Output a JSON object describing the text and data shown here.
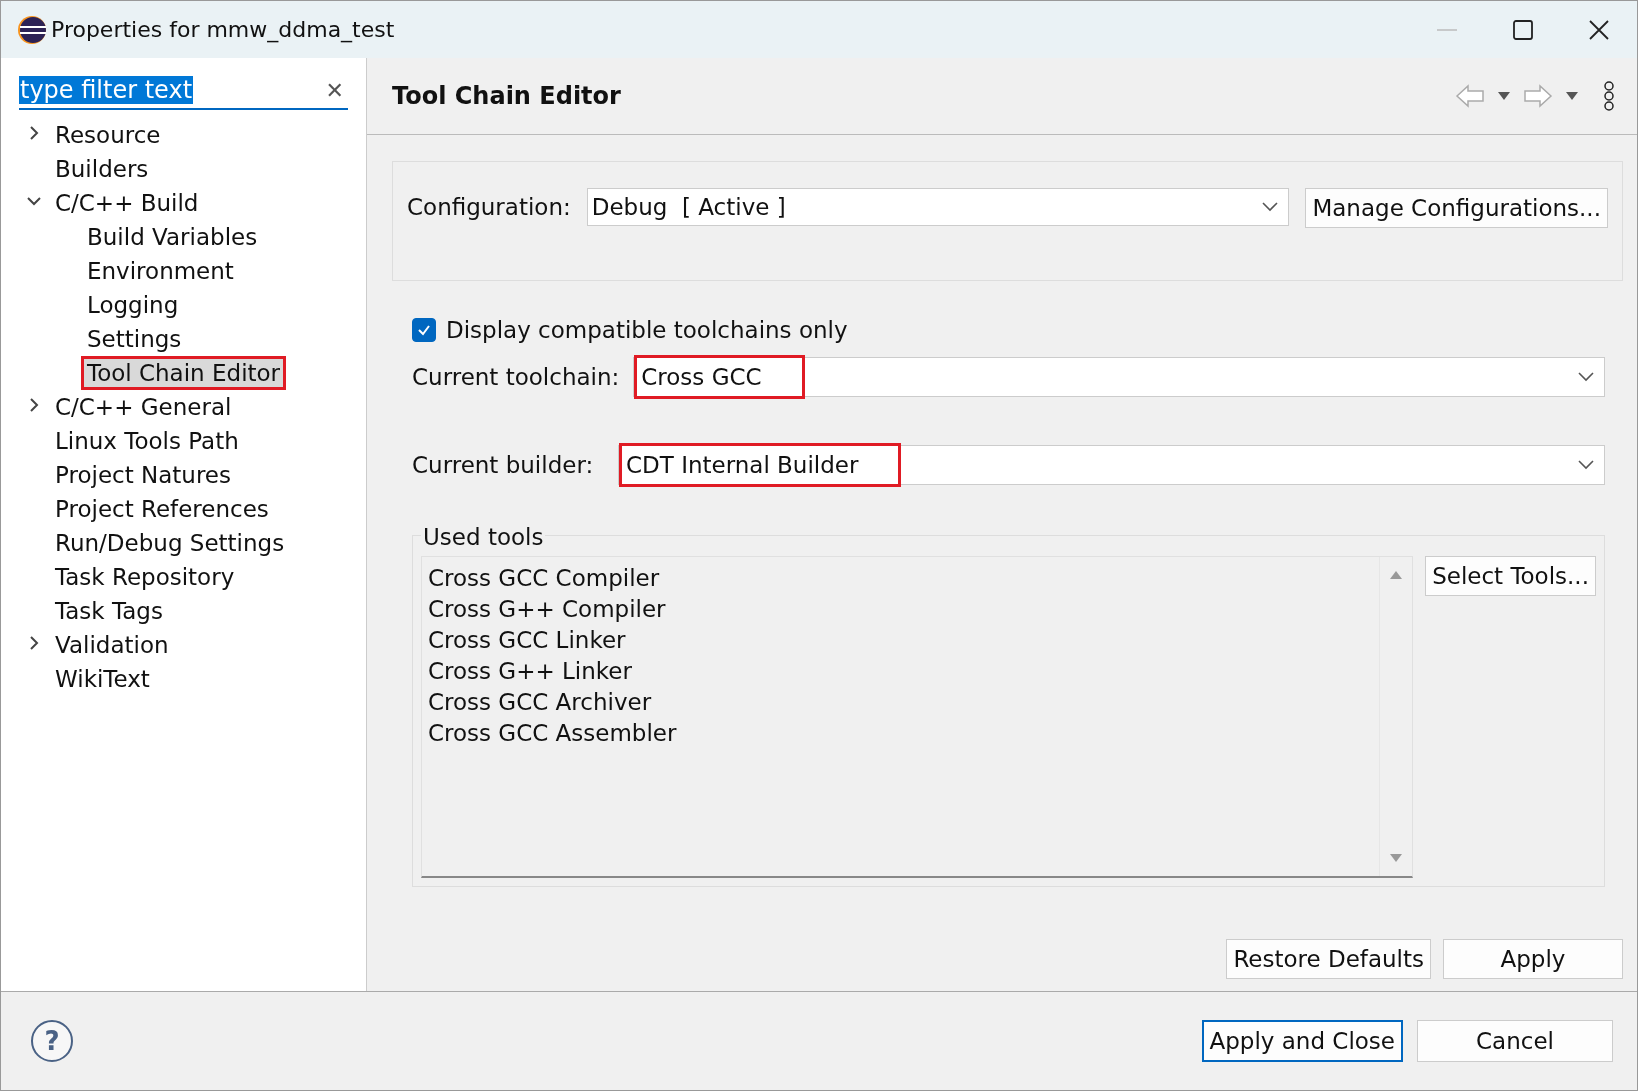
{
  "window": {
    "title": "Properties for mmw_ddma_test"
  },
  "filter": {
    "value": "type filter text",
    "clear": "✕"
  },
  "tree": [
    {
      "label": "Resource",
      "expanded": false,
      "selected": false,
      "highlighted": false
    },
    {
      "label": "Builders",
      "selected": false,
      "highlighted": false
    },
    {
      "label": "C/C++ Build",
      "expanded": true,
      "selected": false,
      "highlighted": false,
      "children": [
        {
          "label": "Build Variables",
          "selected": false,
          "highlighted": false
        },
        {
          "label": "Environment",
          "selected": false,
          "highlighted": false
        },
        {
          "label": "Logging",
          "selected": false,
          "highlighted": false
        },
        {
          "label": "Settings",
          "selected": false,
          "highlighted": false
        },
        {
          "label": "Tool Chain Editor",
          "selected": true,
          "highlighted": true
        }
      ]
    },
    {
      "label": "C/C++ General",
      "expanded": false,
      "selected": false,
      "highlighted": false
    },
    {
      "label": "Linux Tools Path",
      "selected": false,
      "highlighted": false
    },
    {
      "label": "Project Natures",
      "selected": false,
      "highlighted": false
    },
    {
      "label": "Project References",
      "selected": false,
      "highlighted": false
    },
    {
      "label": "Run/Debug Settings",
      "selected": false,
      "highlighted": false
    },
    {
      "label": "Task Repository",
      "selected": false,
      "highlighted": false
    },
    {
      "label": "Task Tags",
      "selected": false,
      "highlighted": false
    },
    {
      "label": "Validation",
      "expanded": false,
      "selected": false,
      "highlighted": false
    },
    {
      "label": "WikiText",
      "selected": false,
      "highlighted": false
    }
  ],
  "page": {
    "title": "Tool Chain Editor",
    "configuration": {
      "label": "Configuration:",
      "value": "Debug  [ Active ]",
      "button": "Manage Configurations..."
    },
    "compatible_only": {
      "label": "Display compatible toolchains only",
      "checked": true
    },
    "toolchain": {
      "label": "Current toolchain:",
      "value": "Cross GCC",
      "highlighted": true
    },
    "builder": {
      "label": "Current builder:",
      "value": "CDT Internal Builder",
      "highlighted": true
    },
    "used_tools": {
      "label": "Used tools",
      "items": [
        "Cross GCC Compiler",
        "Cross G++ Compiler",
        "Cross GCC Linker",
        "Cross G++ Linker",
        "Cross GCC Archiver",
        "Cross GCC Assembler"
      ],
      "button": "Select Tools..."
    },
    "buttons": [
      "Restore Defaults",
      "Apply"
    ]
  },
  "footer": {
    "help": "?",
    "buttons": [
      {
        "label": "Apply and Close",
        "kind": "default"
      },
      {
        "label": "Cancel",
        "kind": "normal"
      }
    ]
  }
}
